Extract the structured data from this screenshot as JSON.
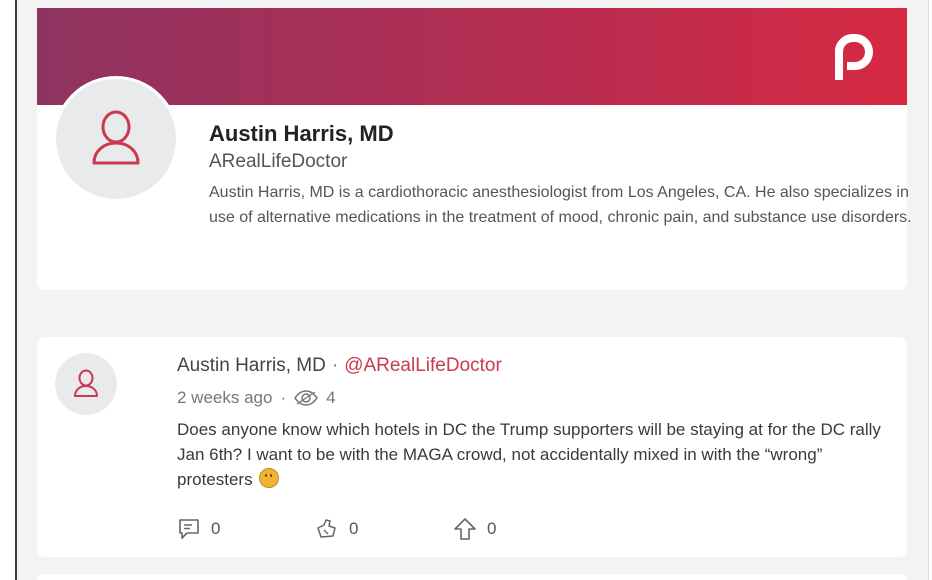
{
  "brand": {
    "logo_icon": "parler-logo-icon",
    "banner_gradient": [
      "#8e3460",
      "#d62a43"
    ]
  },
  "profile": {
    "name": "Austin Harris, MD",
    "handle": "ARealLifeDoctor",
    "bio": "Austin Harris, MD is a cardiothoracic anesthesiologist from Los Angeles, CA. He also specializes in use of alternative medications in the treatment of mood, chronic pain, and substance use disorders.",
    "avatar_icon": "user-avatar-icon"
  },
  "post": {
    "author": "Austin Harris, MD",
    "separator": "·",
    "mention": "@ARealLifeDoctor",
    "time_ago": "2 weeks ago",
    "meta_separator": "·",
    "views_icon": "eye-icon",
    "views": "4",
    "body": "Does anyone know which hotels in DC the Trump supporters will be staying at for the DC rally Jan 6th? I want to be with the MAGA crowd, not accidentally mixed in with the “wrong” protesters",
    "emoji": "grimacing-face-emoji",
    "actions": {
      "comments": {
        "icon": "comment-icon",
        "count": "0"
      },
      "echoes": {
        "icon": "echo-icon",
        "count": "0"
      },
      "upvotes": {
        "icon": "upvote-icon",
        "count": "0"
      }
    }
  },
  "colors": {
    "accent": "#c93a4e",
    "text_primary": "#222222",
    "text_secondary": "#555555"
  }
}
